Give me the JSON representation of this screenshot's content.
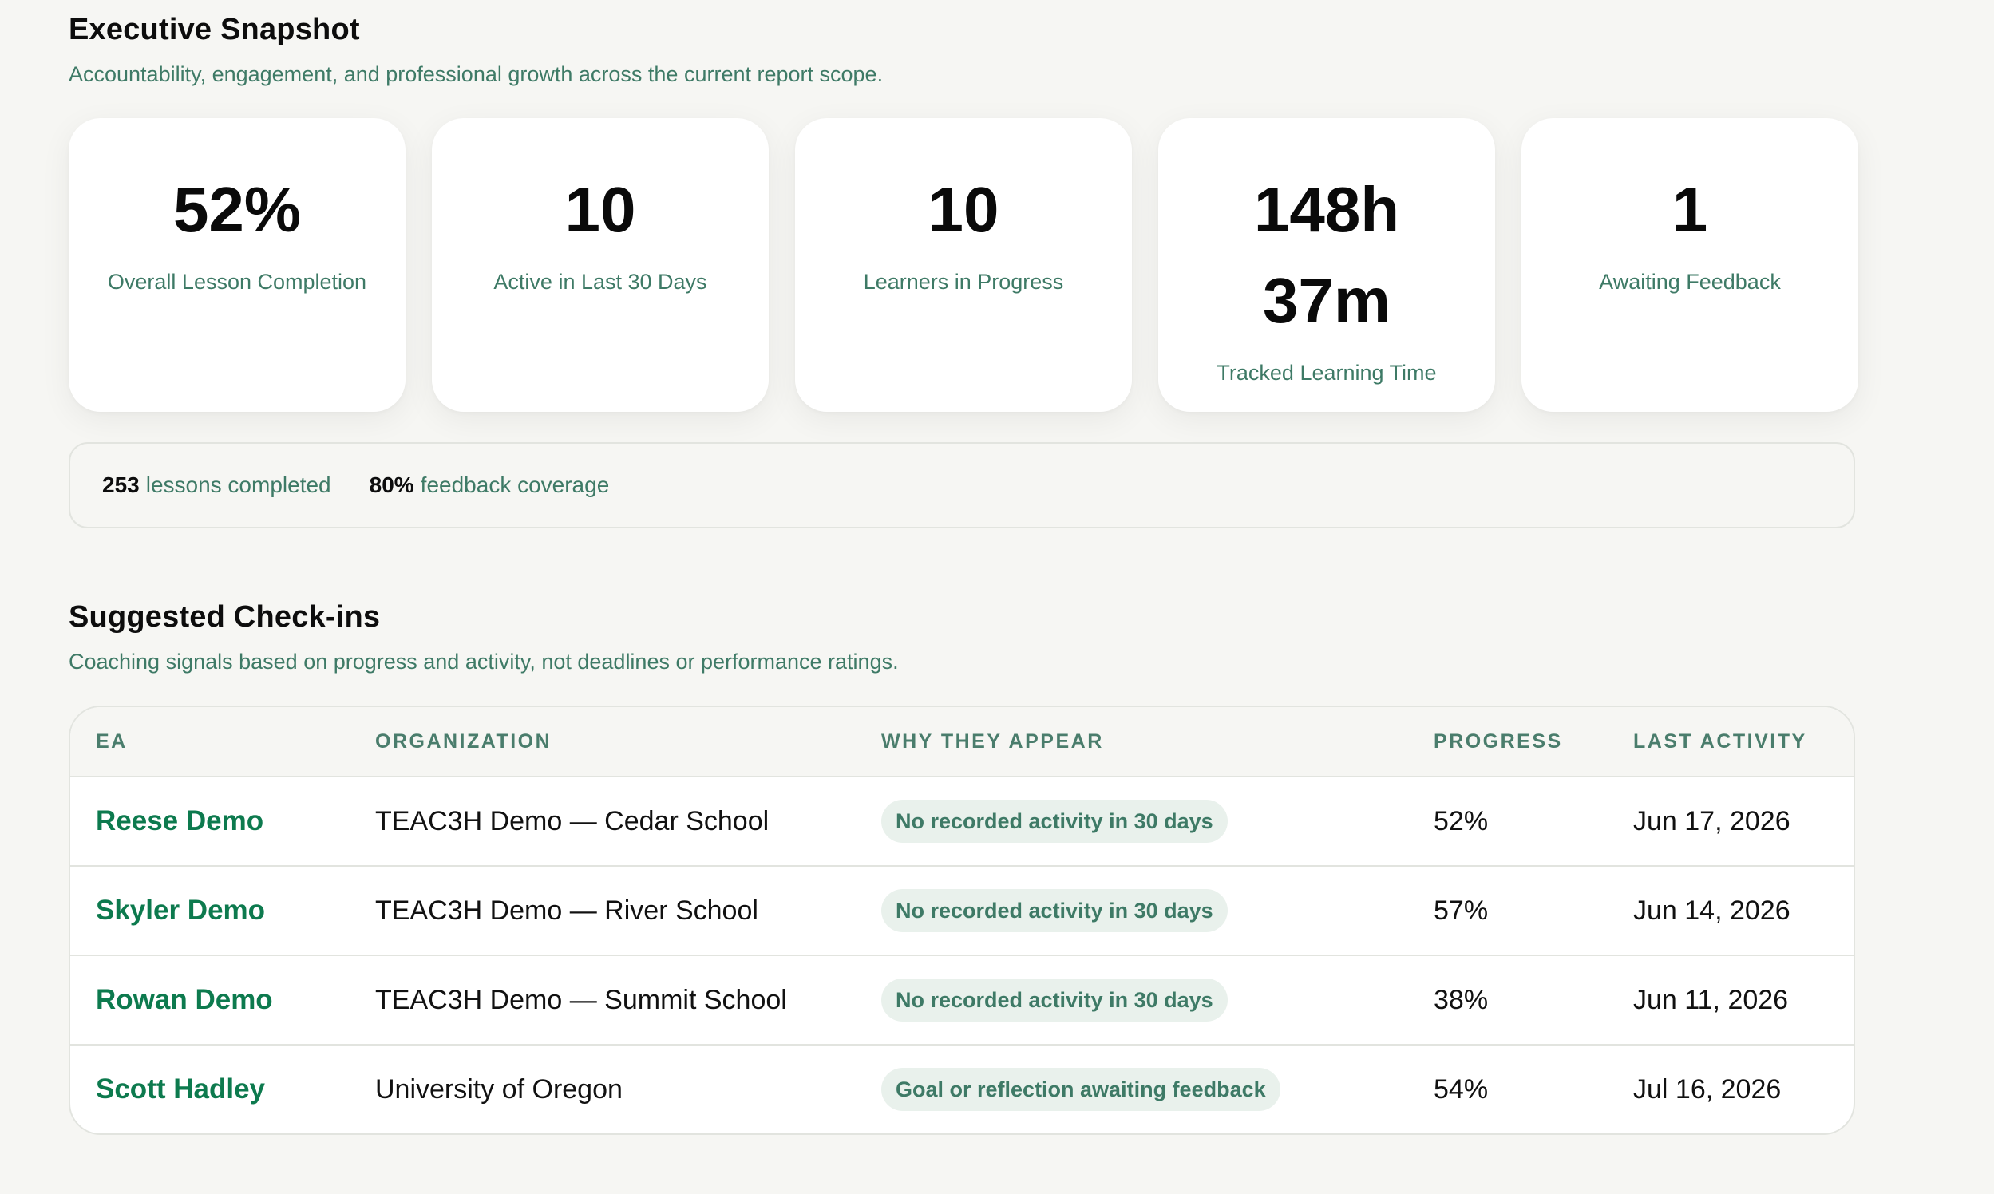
{
  "snapshot": {
    "title": "Executive Snapshot",
    "subtitle": "Accountability, engagement, and professional growth across the current report scope.",
    "cards": [
      {
        "value": "52%",
        "label": "Overall Lesson Completion"
      },
      {
        "value": "10",
        "label": "Active in Last 30 Days"
      },
      {
        "value": "10",
        "label": "Learners in Progress"
      },
      {
        "value": "148h 37m",
        "label": "Tracked Learning Time"
      },
      {
        "value": "1",
        "label": "Awaiting Feedback"
      }
    ],
    "summary": {
      "lessons_value": "253",
      "lessons_label": "lessons completed",
      "coverage_value": "80%",
      "coverage_label": "feedback coverage"
    }
  },
  "checkins": {
    "title": "Suggested Check-ins",
    "subtitle": "Coaching signals based on progress and activity, not deadlines or performance ratings.",
    "columns": [
      "EA",
      "ORGANIZATION",
      "WHY THEY APPEAR",
      "PROGRESS",
      "LAST ACTIVITY"
    ],
    "rows": [
      {
        "name": "Reese Demo",
        "org": "TEAC3H Demo — Cedar School",
        "reason": "No recorded activity in 30 days",
        "progress": "52%",
        "last": "Jun 17, 2026"
      },
      {
        "name": "Skyler Demo",
        "org": "TEAC3H Demo — River School",
        "reason": "No recorded activity in 30 days",
        "progress": "57%",
        "last": "Jun 14, 2026"
      },
      {
        "name": "Rowan Demo",
        "org": "TEAC3H Demo — Summit School",
        "reason": "No recorded activity in 30 days",
        "progress": "38%",
        "last": "Jun 11, 2026"
      },
      {
        "name": "Scott Hadley",
        "org": "University of Oregon",
        "reason": "Goal or reflection awaiting feedback",
        "progress": "54%",
        "last": "Jul 16, 2026"
      }
    ]
  },
  "colors": {
    "accent_green": "#0d7a4e",
    "muted_green": "#3e7a66",
    "badge_bg": "#e9f1ec",
    "page_bg": "#f6f6f3"
  }
}
